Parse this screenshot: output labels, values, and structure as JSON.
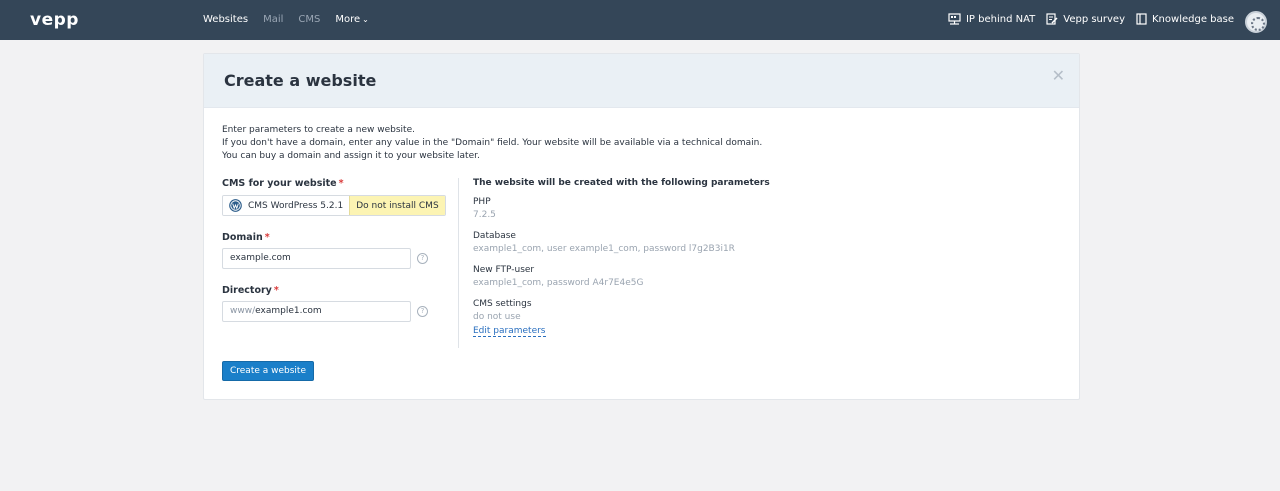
{
  "topbar": {
    "logo": "vepp",
    "nav": [
      {
        "label": "Websites",
        "state": "active"
      },
      {
        "label": "Mail",
        "state": "muted"
      },
      {
        "label": "CMS",
        "state": "muted"
      },
      {
        "label": "More",
        "state": "dropdown"
      }
    ],
    "right_links": [
      {
        "label": "IP behind NAT",
        "icon": "network-icon"
      },
      {
        "label": "Vepp survey",
        "icon": "survey-icon"
      },
      {
        "label": "Knowledge base",
        "icon": "book-icon"
      }
    ],
    "avatar_icon": "avatar-icon"
  },
  "dialog": {
    "title": "Create a website",
    "close_icon": "close-icon",
    "intro": [
      "Enter parameters to create a new website.",
      "If you don't have a domain, enter any value in the \"Domain\" field. Your website will be available via a technical domain.",
      "You can buy a domain and assign it to your website later."
    ],
    "cms": {
      "label": "CMS for your website",
      "required_mark": "*",
      "options": [
        {
          "label": "CMS WordPress 5.2.1",
          "icon": "wordpress-icon",
          "selected": false
        },
        {
          "label": "Do not install CMS",
          "selected": true
        }
      ]
    },
    "domain": {
      "label": "Domain",
      "required_mark": "*",
      "value": "example.com",
      "help": "?"
    },
    "directory": {
      "label": "Directory",
      "required_mark": "*",
      "prefix": "www/",
      "value": "example1.com",
      "help": "?"
    },
    "params": {
      "title": "The website will be created with the following parameters",
      "items": [
        {
          "label": "PHP",
          "value": "7.2.5"
        },
        {
          "label": "Database",
          "value": "example1_com, user example1_com, password l7g2B3i1R"
        },
        {
          "label": "New FTP-user",
          "value": "example1_com, password A4r7E4e5G"
        },
        {
          "label": "CMS settings",
          "value": "do not use"
        }
      ],
      "edit_link": "Edit parameters"
    },
    "submit_label": "Create a website"
  },
  "colors": {
    "topbar": "#344658",
    "accent": "#1a7fc9",
    "selected_option": "#fcf4b3",
    "required": "#d93a3a"
  }
}
